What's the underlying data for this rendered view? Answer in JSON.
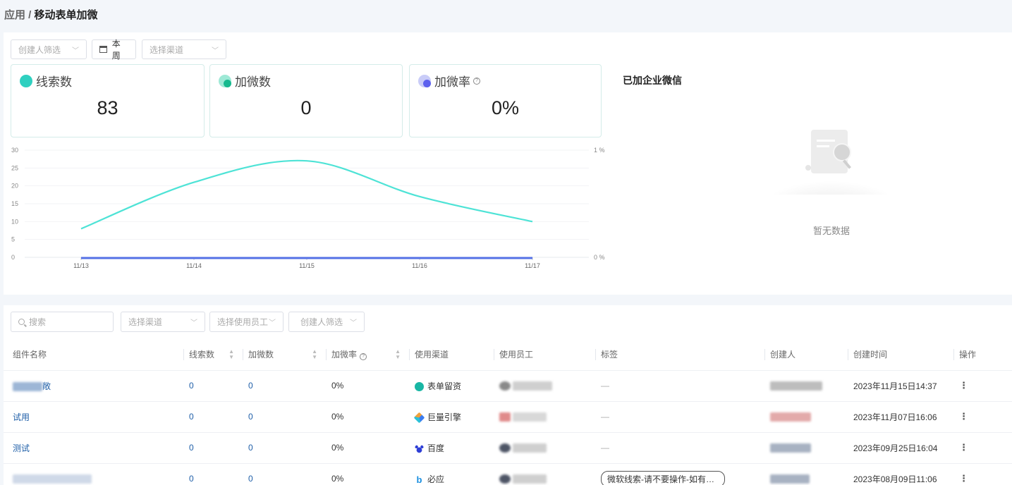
{
  "breadcrumb": {
    "parent": "应用",
    "separator": " / ",
    "current": "移动表单加微"
  },
  "top_filters": {
    "creator": "创建人筛选",
    "date": "本周",
    "channel": "选择渠道"
  },
  "stats": [
    {
      "label": "线索数",
      "value": "83",
      "icon": "leads-icon",
      "color": "#2fd0c0"
    },
    {
      "label": "加微数",
      "value": "0",
      "icon": "wechat-add-icon",
      "color": "#28c9a0"
    },
    {
      "label": "加微率",
      "value": "0%",
      "icon": "rate-icon",
      "color": "#6a6ef0"
    }
  ],
  "right_panel": {
    "title": "已加企业微信",
    "empty_text": "暂无数据"
  },
  "chart_data": {
    "type": "line",
    "categories": [
      "11/13",
      "11/14",
      "11/15",
      "11/16",
      "11/17"
    ],
    "series": [
      {
        "values": [
          8,
          21,
          27,
          17,
          10
        ],
        "axis": "left",
        "color": "#4ee3d6"
      },
      {
        "values": [
          0,
          0,
          0,
          0,
          0
        ],
        "axis": "right",
        "color": "#5470e6"
      }
    ],
    "ylim": [
      0,
      30
    ],
    "y_ticks": [
      "0",
      "5",
      "10",
      "15",
      "20",
      "25",
      "30"
    ],
    "y2_ticks": [
      "0 %",
      "1 %"
    ],
    "grid": true
  },
  "bottom_filters": {
    "search": "搜索",
    "channel": "选择渠道",
    "employee": "选择使用员工",
    "creator": "创建人筛选"
  },
  "table": {
    "columns": [
      "组件名称",
      "线索数",
      "加微数",
      "加微率",
      "使用渠道",
      "使用员工",
      "标签",
      "创建人",
      "创建时间",
      "操作"
    ],
    "rows": [
      {
        "name": "敞",
        "leads": "0",
        "adds": "0",
        "rate": "0%",
        "channel": "表单留资",
        "channel_icon": "form-icon",
        "tag": "—",
        "time": "2023年11月15日14:37"
      },
      {
        "name": "试用",
        "leads": "0",
        "adds": "0",
        "rate": "0%",
        "channel": "巨量引擎",
        "channel_icon": "ocean-engine-icon",
        "tag": "—",
        "time": "2023年11月07日16:06"
      },
      {
        "name": "测试",
        "leads": "0",
        "adds": "0",
        "rate": "0%",
        "channel": "百度",
        "channel_icon": "baidu-icon",
        "tag": "—",
        "time": "2023年09月25日16:04"
      },
      {
        "name": "",
        "leads": "0",
        "adds": "0",
        "rate": "0%",
        "channel": "必应",
        "channel_icon": "bing-icon",
        "tag": "微软线索-请不要操作-如有疑问请联系",
        "time": "2023年08月09日11:06"
      }
    ]
  }
}
